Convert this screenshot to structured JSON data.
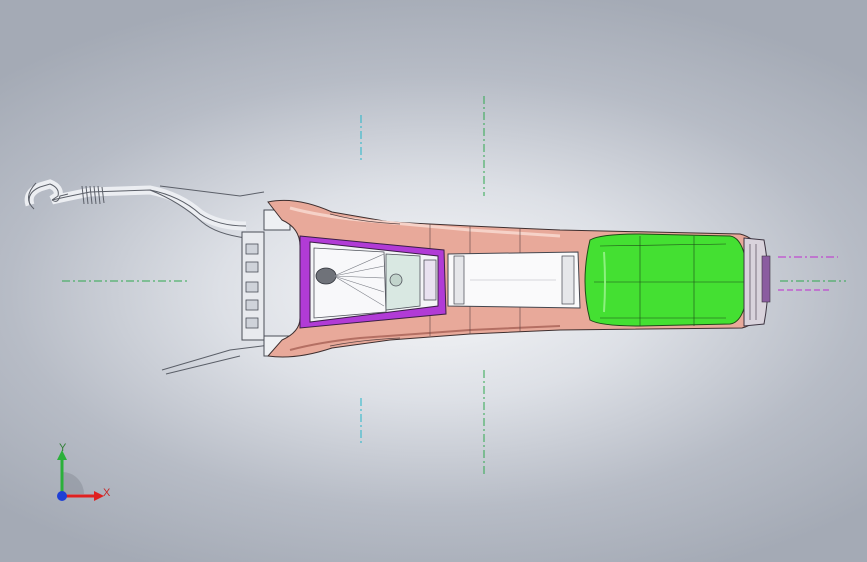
{
  "viewport": {
    "background_center": "#f6f7f9",
    "background_edge": "#a4aab5"
  },
  "model": {
    "console_color": "#e8a99a",
    "lid_color": "#44e032",
    "trim_color": "#b13bd6",
    "centerline_color": "#2fa84f",
    "axis_line_color": "#23b6c9",
    "magenta_line_color": "#c02ad0"
  },
  "triad": {
    "x_label": "X",
    "y_label": "Y",
    "x_color": "#e02020",
    "y_color": "#2bb03a",
    "z_color": "#1e3fd6"
  }
}
